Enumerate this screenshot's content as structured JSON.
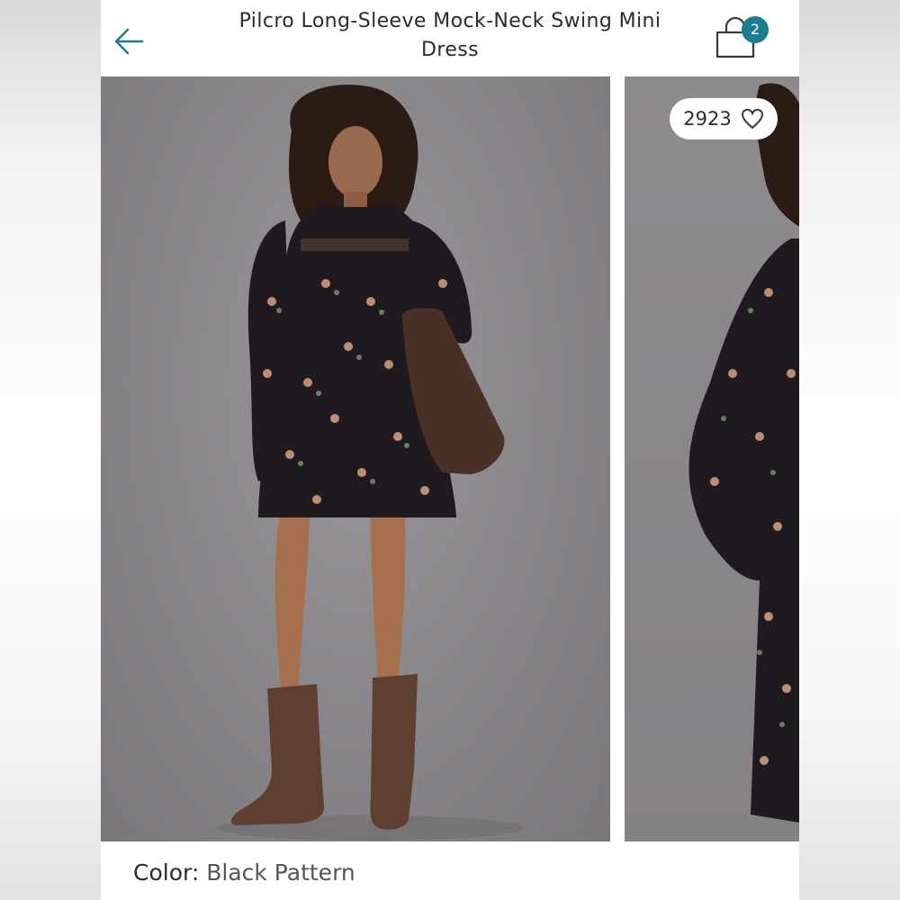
{
  "header": {
    "title": "Pilcro Long-Sleeve Mock-Neck Swing Mini Dress",
    "bag_count": "2"
  },
  "gallery": {
    "likes": "2923"
  },
  "product": {
    "color_label": "Color:",
    "color_value": "Black Pattern"
  },
  "colors": {
    "accent": "#1b7d8f",
    "text": "#2b2b2b"
  },
  "icons": {
    "back": "arrow-left-icon",
    "bag": "shopping-bag-icon",
    "like": "heart-outline-icon"
  }
}
